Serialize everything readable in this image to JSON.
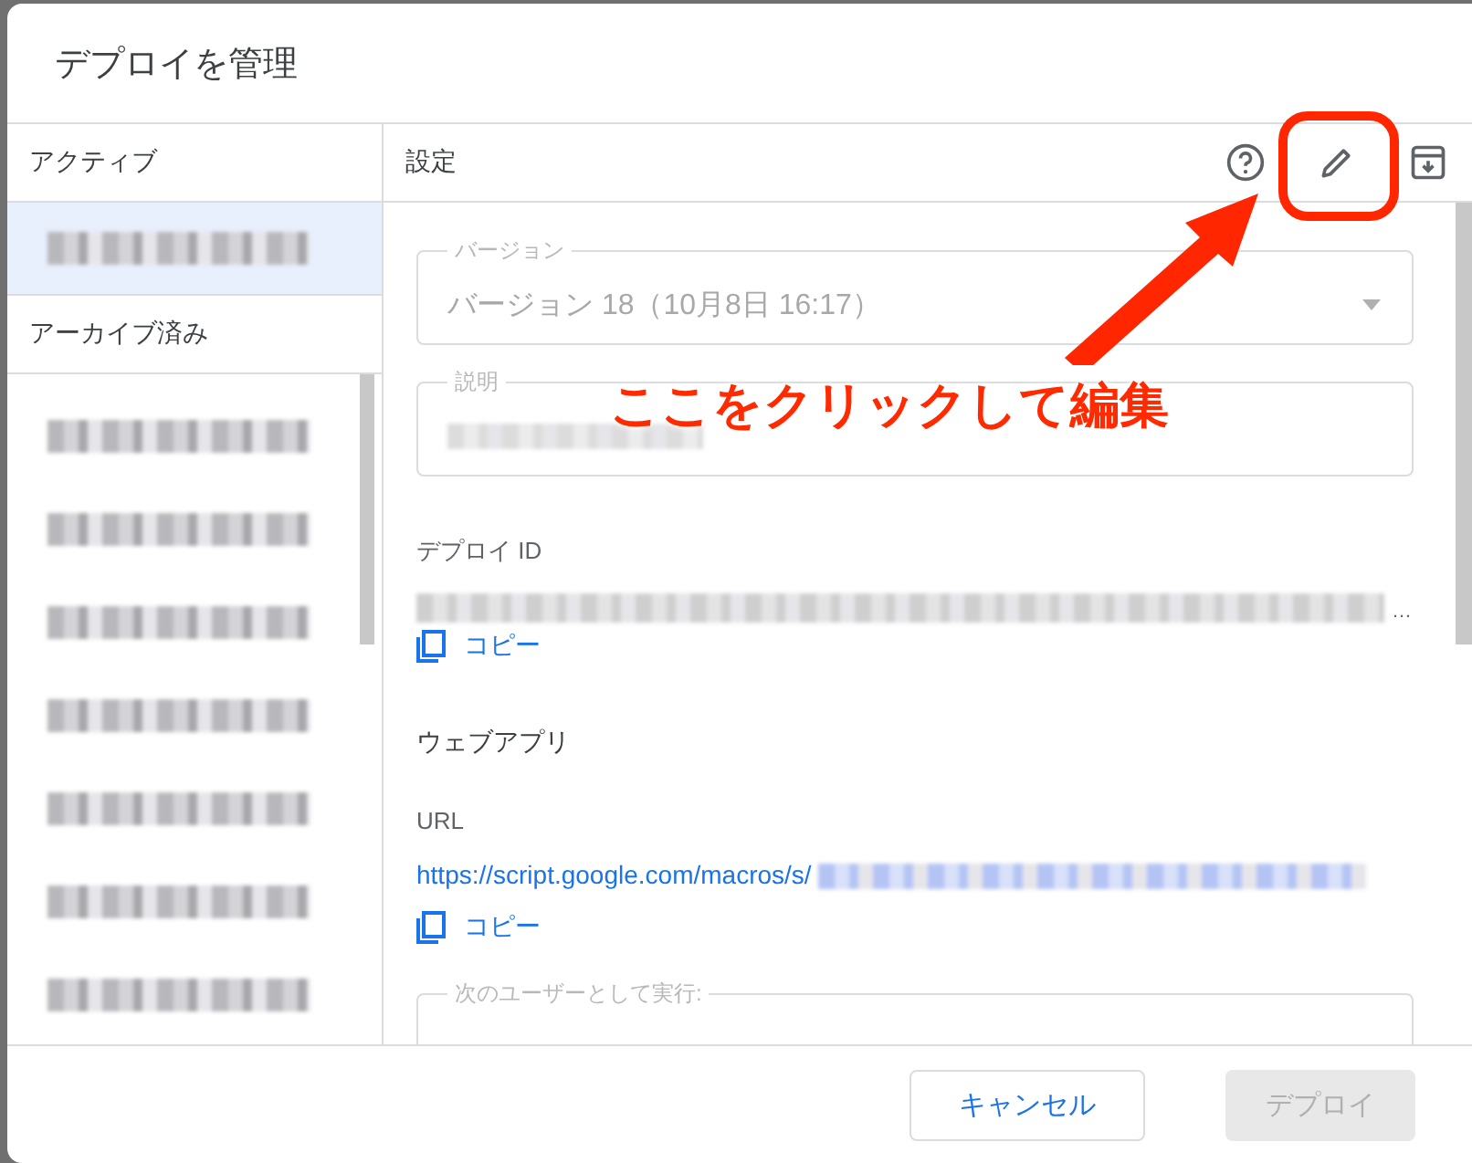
{
  "dialog": {
    "title": "デプロイを管理"
  },
  "sidebar": {
    "sections": [
      {
        "heading": "アクティブ",
        "items": [
          {
            "selected": true
          }
        ]
      },
      {
        "heading": "アーカイブ済み",
        "items": [
          {
            "selected": false
          },
          {
            "selected": false
          },
          {
            "selected": false
          },
          {
            "selected": false
          },
          {
            "selected": false
          },
          {
            "selected": false
          },
          {
            "selected": false
          }
        ]
      }
    ]
  },
  "settings": {
    "heading": "設定",
    "toolbar": [
      {
        "kind": "help"
      },
      {
        "kind": "edit"
      },
      {
        "kind": "archive"
      }
    ],
    "version_field": {
      "label": "バージョン",
      "value": "バージョン 18（10月8日 16:17）",
      "disabled": true
    },
    "description_field": {
      "label": "説明"
    },
    "deployment_id": {
      "label": "デプロイ ID",
      "ellipsis": "…",
      "copy": "コピー"
    },
    "web_app": {
      "heading": "ウェブアプリ",
      "url_label": "URL",
      "url": "https://script.google.com/macros/s/",
      "copy": "コピー"
    },
    "execute_as_field": {
      "label": "次のユーザーとして実行:"
    }
  },
  "footer": {
    "buttons": [
      {
        "label": "キャンセル",
        "disabled": false
      },
      {
        "label": "デプロイ",
        "disabled": true
      }
    ]
  },
  "annotation": {
    "text": "ここをクリックして編集"
  }
}
